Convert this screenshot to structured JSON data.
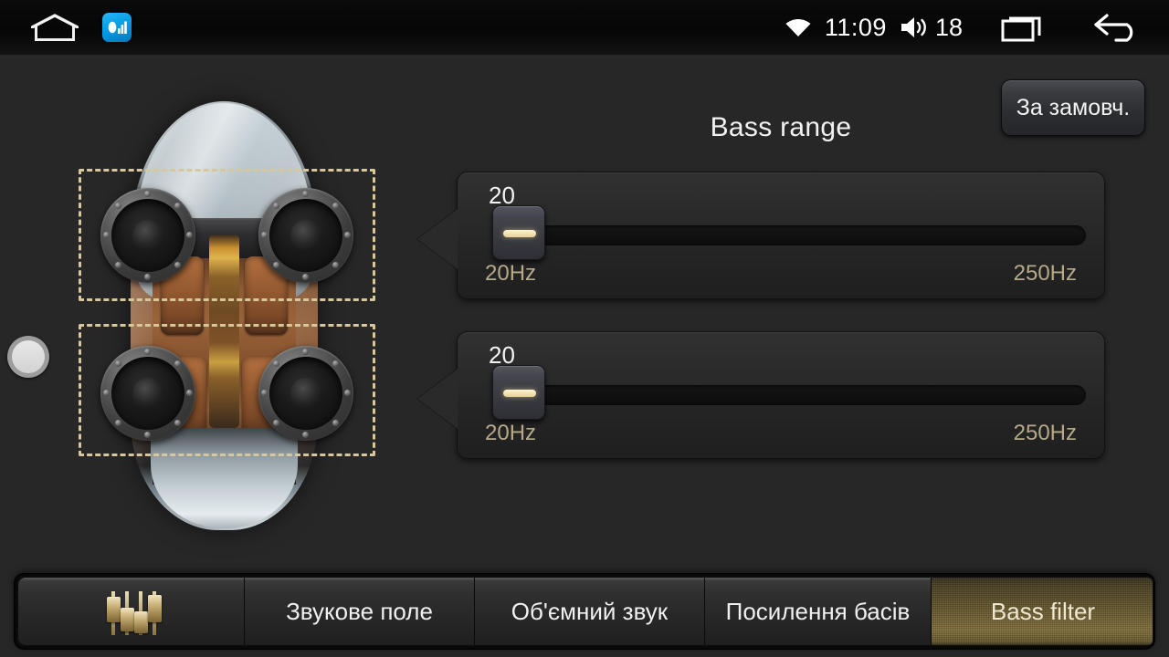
{
  "statusbar": {
    "home_icon": "home-icon",
    "app_icon": "music-equalizer-app-icon",
    "wifi_icon": "wifi-icon",
    "time": "11:09",
    "volume_icon": "volume-icon",
    "volume_level": "18",
    "recents_icon": "recents-icon",
    "back_icon": "back-arrow-icon"
  },
  "default_button": {
    "label": "За замовч."
  },
  "left_knob": {
    "name": "rotary-knob"
  },
  "car": {
    "zones": [
      {
        "name": "front-speakers-zone"
      },
      {
        "name": "rear-speakers-zone"
      }
    ],
    "speakers": [
      {
        "name": "front-left-speaker"
      },
      {
        "name": "front-right-speaker"
      },
      {
        "name": "rear-left-speaker"
      },
      {
        "name": "rear-right-speaker"
      }
    ]
  },
  "main": {
    "title": "Bass range",
    "sliders": [
      {
        "name": "front-bass-range-slider",
        "value": "20",
        "min_label": "20Hz",
        "max_label": "250Hz"
      },
      {
        "name": "rear-bass-range-slider",
        "value": "20",
        "min_label": "20Hz",
        "max_label": "250Hz"
      }
    ]
  },
  "tabs": [
    {
      "label": "",
      "icon": "equalizer-icon",
      "active": false
    },
    {
      "label": "Звукове поле",
      "icon": "",
      "active": false
    },
    {
      "label": "Об'ємний звук",
      "icon": "",
      "active": false
    },
    {
      "label": "Посилення басів",
      "icon": "",
      "active": false
    },
    {
      "label": "Bass filter",
      "icon": "",
      "active": true
    }
  ],
  "colors": {
    "background": "#272727",
    "accent_gold_light": "#f0e0b4",
    "accent_gold_dark": "#8a7340",
    "panel": "#2b2b2b",
    "active_tab": "#6d5f33",
    "zone_dash": "#d7c79a"
  }
}
